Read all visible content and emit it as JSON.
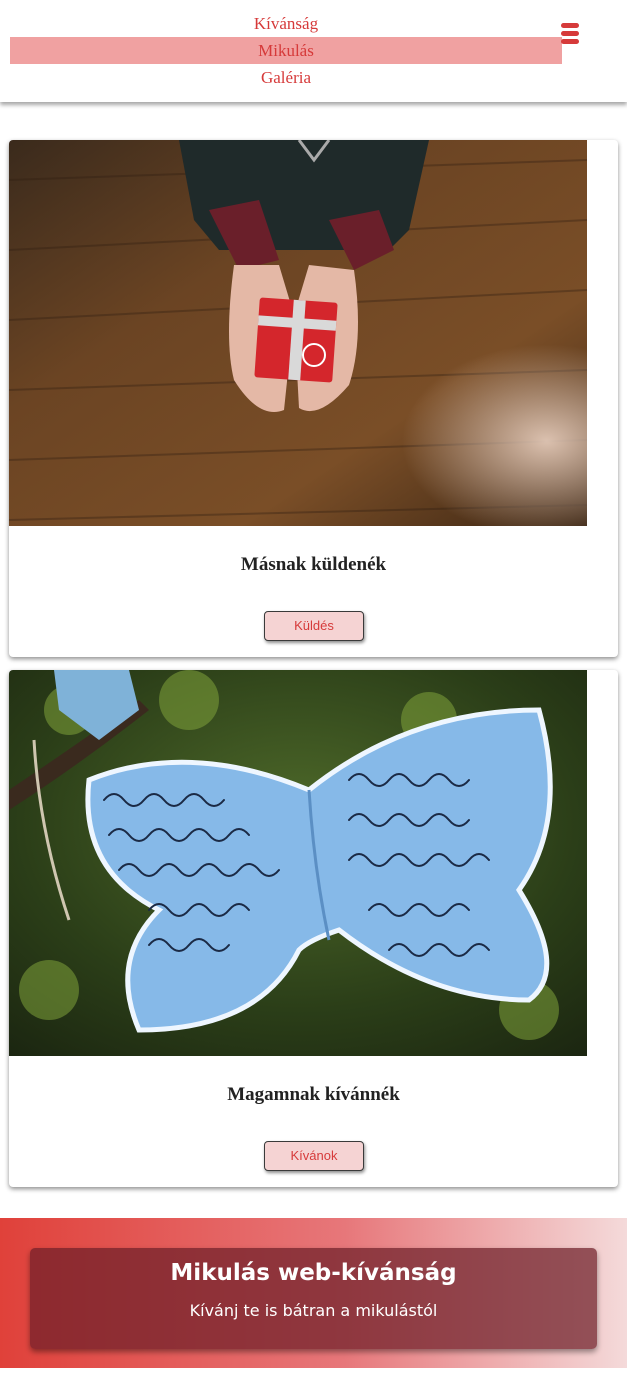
{
  "nav": {
    "items": [
      {
        "label": "Kívánság",
        "active": false
      },
      {
        "label": "Mikulás",
        "active": true
      },
      {
        "label": "Galéria",
        "active": false
      }
    ],
    "menu_icon": "hamburger-menu-icon"
  },
  "cards": [
    {
      "image": "gift-in-hands-photo",
      "title": "Másnak küldenék",
      "button_label": "Küldés"
    },
    {
      "image": "paper-butterfly-wish-photo",
      "title": "Magamnak kívánnék",
      "button_label": "Kívánok"
    }
  ],
  "banner": {
    "title": "Mikulás web-kívánság",
    "subtitle": "Kívánj te is bátran a mikulástól"
  },
  "colors": {
    "accent": "#d63a3a",
    "nav_active_bg": "#f0a1a1",
    "button_bg": "#f5d3d3",
    "banner_gradient_start": "#e0413a",
    "banner_gradient_end": "#f4dada"
  }
}
